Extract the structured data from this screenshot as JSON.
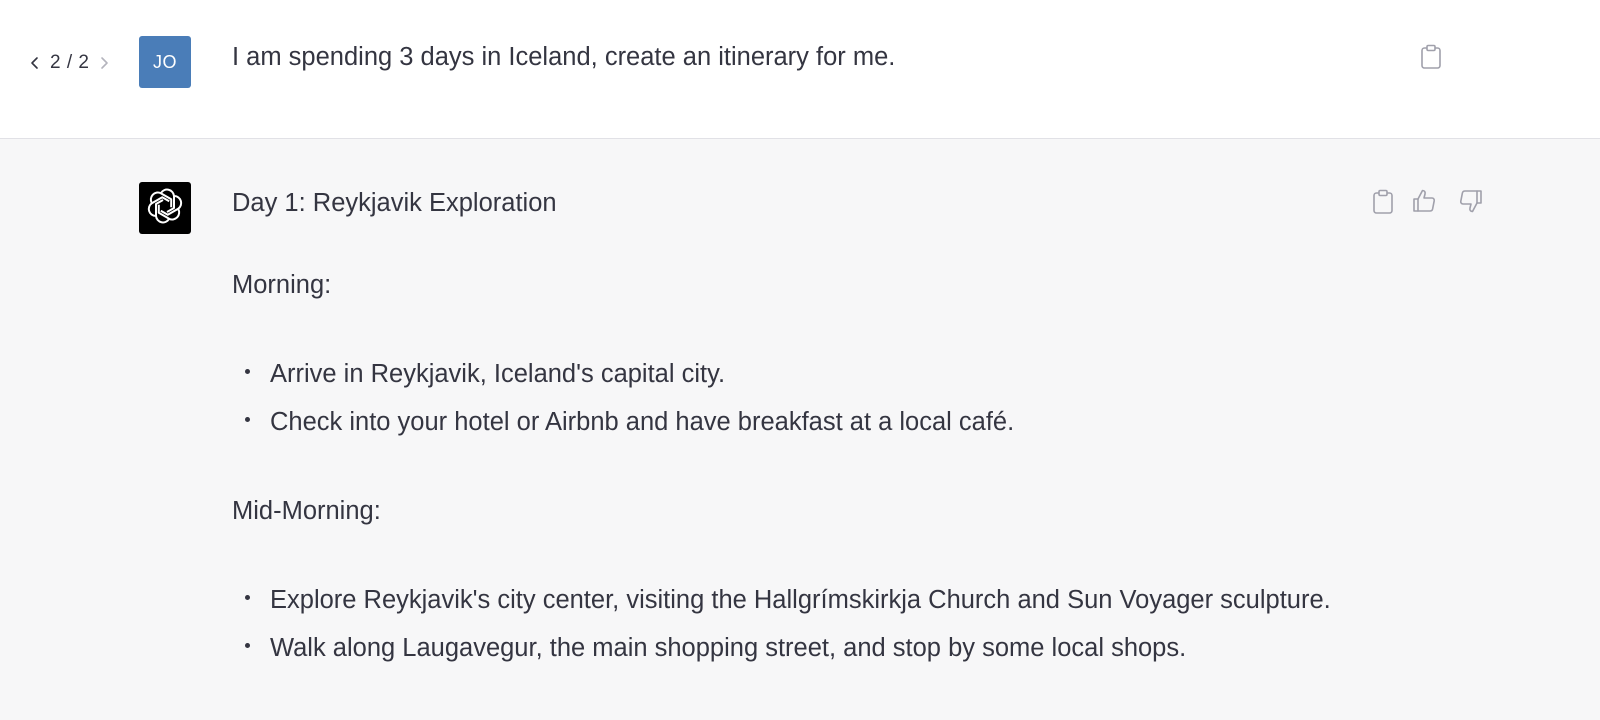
{
  "pager": {
    "count": "2 / 2",
    "prev_icon": "chevron-left-icon",
    "next_icon": "chevron-right-icon"
  },
  "user": {
    "avatar_initials": "JO",
    "avatar_color": "#4a7db8",
    "message": "I am spending 3 days in Iceland, create an itinerary for me.",
    "copy_icon": "clipboard-icon"
  },
  "assistant": {
    "avatar_icon": "openai-logo-icon",
    "heading": "Day 1: Reykjavik Exploration",
    "sections": [
      {
        "label": "Morning:",
        "items": [
          "Arrive in Reykjavik, Iceland's capital city.",
          "Check into your hotel or Airbnb and have breakfast at a local café."
        ]
      },
      {
        "label": "Mid-Morning:",
        "items": [
          "Explore Reykjavik's city center, visiting the Hallgrímskirkja Church and Sun Voyager sculpture.",
          "Walk along Laugavegur, the main shopping street, and stop by some local shops."
        ]
      }
    ],
    "actions": [
      "clipboard-icon",
      "thumbs-up-icon",
      "thumbs-down-icon"
    ]
  },
  "colors": {
    "user_background": "#ffffff",
    "assistant_background": "#f7f7f8",
    "text": "#343541",
    "icon": "#a0a0ab"
  }
}
